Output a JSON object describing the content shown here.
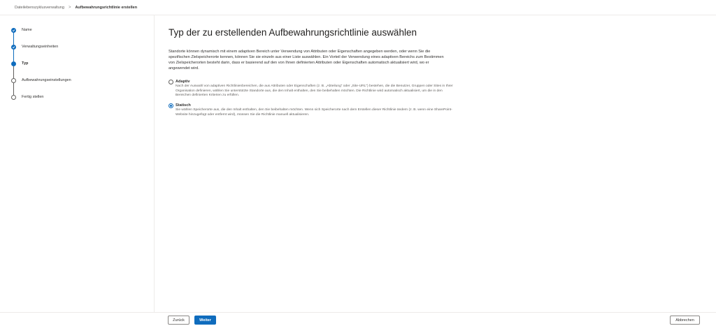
{
  "breadcrumb": {
    "parent": "Dateilebenszyklusverwaltung",
    "separator": ">",
    "current": "Aufbewahrungsrichtlinie erstellen"
  },
  "steps": [
    {
      "label": "Name",
      "state": "done"
    },
    {
      "label": "Verwaltungseinheiten",
      "state": "done"
    },
    {
      "label": "Typ",
      "state": "current"
    },
    {
      "label": "Aufbewahrungseinstellungen",
      "state": "todo"
    },
    {
      "label": "Fertig stellen",
      "state": "todo"
    }
  ],
  "main": {
    "title": "Typ der zu erstellenden Aufbewahrungsrichtlinie auswählen",
    "description": "Standorte können dynamisch mit einem adaptiven Bereich unter Verwendung von Attributen oder Eigenschaften angegeben werden, oder wenn Sie die spezifischen Zielspeicherorte kennen, können Sie sie einzeln aus einer Liste auswählen. Ein Vorteil der Verwendung eines adaptiven Bereichs zum Bestimmen von Zielspeicherorten besteht darin, dass er basierend auf den von Ihnen definierten Attributen oder Eigenschaften automatisch aktualisiert wird, wo er angewendet wird.",
    "options": [
      {
        "title": "Adaptiv",
        "text": "Nach der Auswahl von adaptiven Richtlinienbereichen, die aus Attributen oder Eigenschaften (z. B. „Abteilung“ oder „Site-URL“) bestehen, die die Benutzer, Gruppen oder Sites in Ihrer Organisation definieren, wählen Sie unterstützte Standorte aus, die den Inhalt enthalten, den Sie beibehalten möchten. Die Richtlinie wird automatisch aktualisiert, um die in den Bereichen definierten Kriterien zu erfüllen.",
        "selected": false
      },
      {
        "title": "Statisch",
        "text": "Sie wählen Speicherorte aus, die den Inhalt enthalten, den Sie beibehalten möchten. Wenn sich Speicherorte nach dem Erstellen dieser Richtlinie ändern (z. B. wenn eine SharePoint-Website hinzugefügt oder entfernt wird), müssen Sie die Richtlinie manuell aktualisieren.",
        "selected": true
      }
    ]
  },
  "footer": {
    "back_label": "Zurück",
    "next_label": "Weiter",
    "cancel_label": "Abbrechen"
  },
  "colors": {
    "accent": "#0f6cbd",
    "border": "#edebe9",
    "text": "#323130",
    "muted": "#605e5c"
  }
}
